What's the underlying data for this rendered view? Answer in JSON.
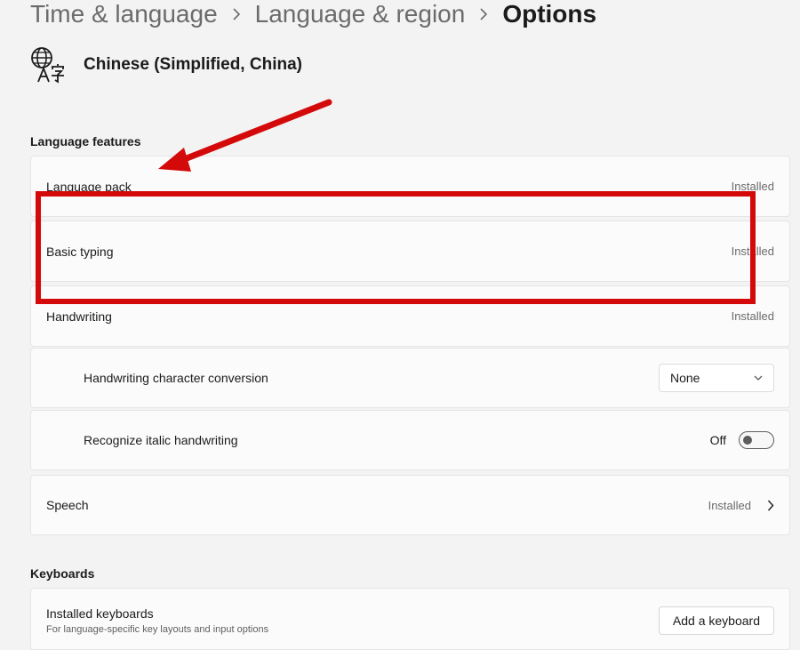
{
  "breadcrumb": {
    "items": [
      "Time & language",
      "Language & region",
      "Options"
    ]
  },
  "language": {
    "icon": "language-icon",
    "name": "Chinese (Simplified, China)"
  },
  "language_features": {
    "title": "Language features",
    "rows": [
      {
        "label": "Language pack",
        "status": "Installed"
      },
      {
        "label": "Basic typing",
        "status": "Installed"
      },
      {
        "label": "Handwriting",
        "status": "Installed"
      }
    ],
    "handwriting_conversion": {
      "label": "Handwriting character conversion",
      "value": "None"
    },
    "italic_handwriting": {
      "label": "Recognize italic handwriting",
      "state": "Off"
    },
    "speech": {
      "label": "Speech",
      "status": "Installed"
    }
  },
  "keyboards": {
    "title": "Keyboards",
    "installed_label": "Installed keyboards",
    "installed_desc": "For language-specific key layouts and input options",
    "add_button": "Add a keyboard"
  },
  "annotation": {
    "color": "#d40a0a"
  }
}
